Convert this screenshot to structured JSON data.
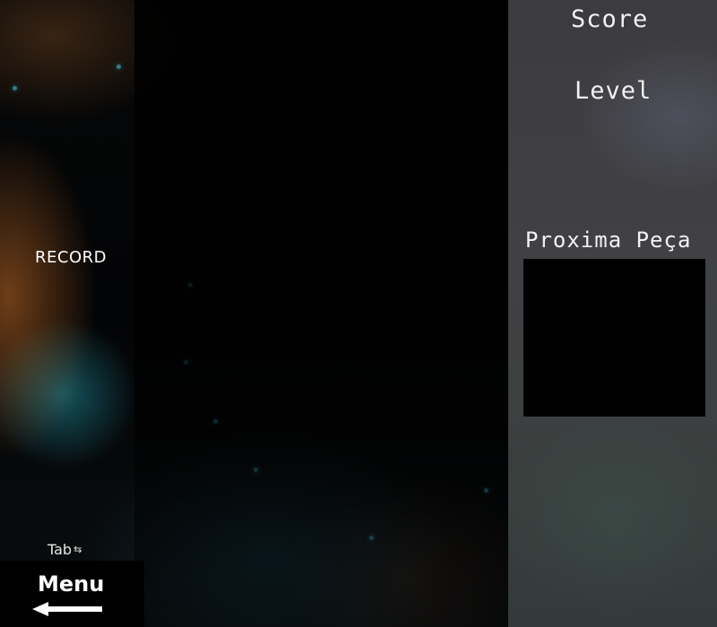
{
  "hud": {
    "score_label": "Score",
    "level_label": "Level",
    "next_piece_label": "Proxima Peça",
    "record_label": "RECORD"
  },
  "controls": {
    "tab_hint_label": "Tab",
    "tab_hint_icon": "tab-arrows-icon",
    "menu_label": "Menu",
    "menu_icon": "back-arrow-icon"
  },
  "colors": {
    "text": "#f2f2f2",
    "panel_background": "#3e3e42",
    "board_background": "#000000",
    "next_piece_box": "#000000"
  }
}
